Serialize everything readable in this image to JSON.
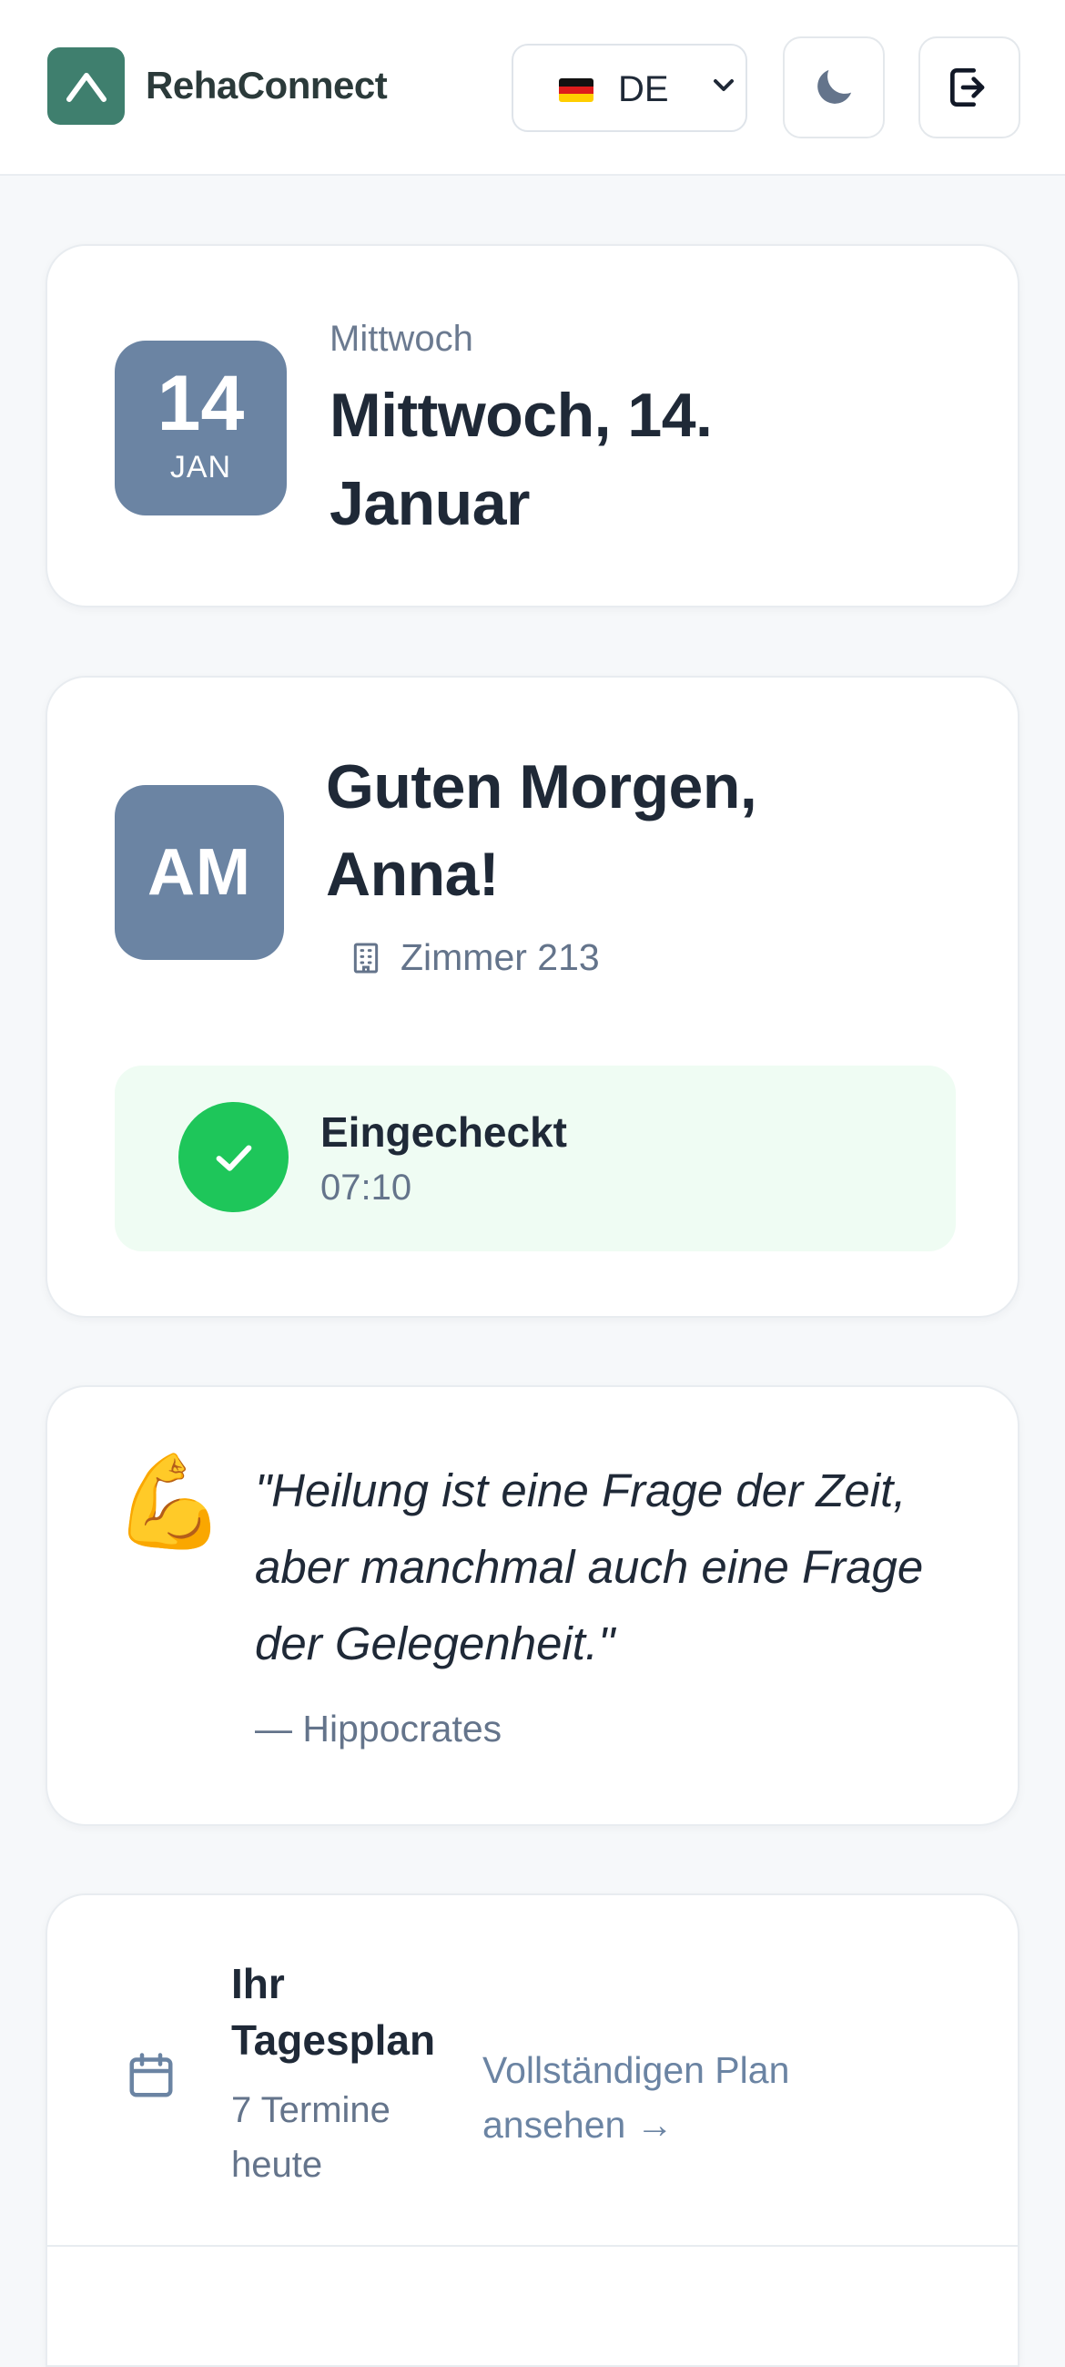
{
  "header": {
    "brand": "RehaConnect",
    "language": {
      "code": "DE",
      "flag": "german-flag"
    },
    "theme_toggle_icon": "moon-icon",
    "logout_icon": "logout-icon",
    "colors": {
      "logo": "#3f7f6e"
    }
  },
  "date_card": {
    "day": "14",
    "month": "JAN",
    "weekday": "Mittwoch",
    "long_date": "Mittwoch, 14. Januar",
    "badge_color": "#6b84a3"
  },
  "greeting_card": {
    "avatar_initials": "AM",
    "greeting": "Guten Morgen, Anna!",
    "room": "Zimmer 213",
    "checkin": {
      "title": "Eingecheckt",
      "time": "07:10",
      "status_color": "#1ec65a"
    }
  },
  "quote_card": {
    "icon": "💪",
    "text": "\"Heilung ist eine Frage der Zeit, aber manchmal auch eine Frage der Gelegenheit.\"",
    "author": "— Hippocrates"
  },
  "plan_card": {
    "title": "Ihr Tagesplan",
    "count": "7 Termine heute",
    "link": "Vollständigen Plan ansehen →"
  }
}
